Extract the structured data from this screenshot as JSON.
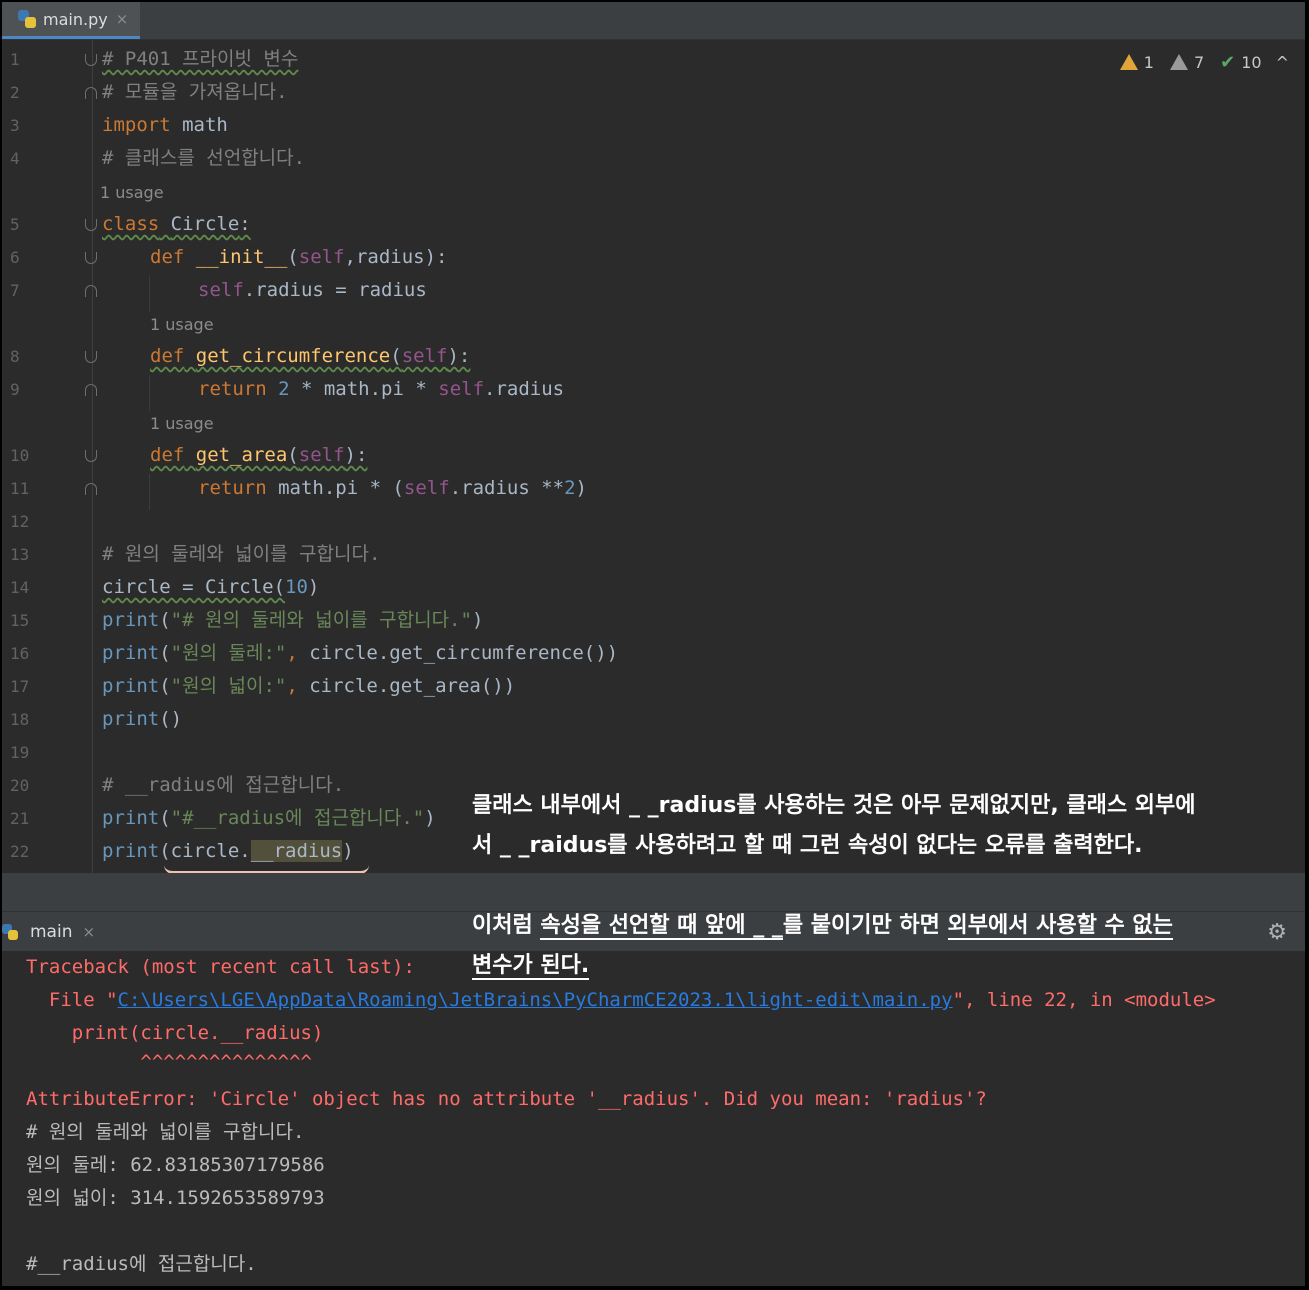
{
  "tab": {
    "filename": "main.py",
    "close": "×"
  },
  "inspections": {
    "warnings": "1",
    "weak_warnings": "7",
    "ok": "10",
    "collapse": "^"
  },
  "hints": {
    "usage_label": "1 usage"
  },
  "lines": {
    "l1": {
      "num": "1",
      "text": "# P401 프라이빗 변수"
    },
    "l2": {
      "num": "2",
      "text": "# 모듈을 가져옵니다."
    },
    "l3": {
      "num": "3",
      "kw": "import",
      "rest": " math"
    },
    "l4": {
      "num": "4",
      "text": "# 클래스를 선언합니다."
    },
    "l5": {
      "num": "5",
      "kw": "class",
      "name": "Circle",
      "tail": ":"
    },
    "l6": {
      "num": "6",
      "kw": "def",
      "name": "__init__",
      "p1": "(",
      "self": "self",
      "p2": ",radius):"
    },
    "l7": {
      "num": "7",
      "self": "self",
      "rest": ".radius = radius"
    },
    "l8": {
      "num": "8",
      "kw": "def",
      "name": "get_circumference",
      "p1": "(",
      "self": "self",
      "p2": "):"
    },
    "l9": {
      "num": "9",
      "kw": "return",
      "num_val": "2",
      "mid": " * math.pi * ",
      "self": "self",
      "rest": ".radius"
    },
    "l10": {
      "num": "10",
      "kw": "def",
      "name": "get_area",
      "p1": "(",
      "self": "self",
      "p2": "):"
    },
    "l11": {
      "num": "11",
      "kw": "return",
      "mid": " math.pi * (",
      "self": "self",
      "rest": ".radius **",
      "num_val": "2",
      "tail": ")"
    },
    "l12": {
      "num": "12"
    },
    "l13": {
      "num": "13",
      "text": "# 원의 둘레와 넓이를 구합니다."
    },
    "l14": {
      "num": "14",
      "pre": "circle = Circle(",
      "num_val": "10",
      "tail": ")"
    },
    "l15": {
      "num": "15",
      "fn": "print",
      "p1": "(",
      "str": "\"# 원의 둘레와 넓이를 구합니다.\"",
      "tail": ")"
    },
    "l16": {
      "num": "16",
      "fn": "print",
      "p1": "(",
      "str": "\"원의 둘레:\"",
      "comma": ",",
      "rest": " circle.get_circumference())"
    },
    "l17": {
      "num": "17",
      "fn": "print",
      "p1": "(",
      "str": "\"원의 넓이:\"",
      "comma": ",",
      "rest": " circle.get_area())"
    },
    "l18": {
      "num": "18",
      "fn": "print",
      "rest": "()"
    },
    "l19": {
      "num": "19"
    },
    "l20": {
      "num": "20",
      "text": "# __radius에 접근합니다."
    },
    "l21": {
      "num": "21",
      "fn": "print",
      "p1": "(",
      "str": "\"#__radius에 접근합니다.\"",
      "tail": ")"
    },
    "l22": {
      "num": "22",
      "fn": "print",
      "p1": "(",
      "obj": "circle.",
      "attr": "__radius",
      "tail": ")"
    }
  },
  "annotation": {
    "line1": "클래스 내부에서 _ _radius를 사용하는 것은 아무 문제없지만, 클래스 외부에",
    "line2": "서 _ _raidus를 사용하려고 할 때 그런 속성이 없다는 오류를 출력한다.",
    "line3_a": "이처럼 ",
    "line3_b": "속성을 선언할 때 앞에 _ _",
    "line3_c": "를 붙이기만 하면 ",
    "line3_d": "외부에서 사용할 수 없는",
    "line4": "변수가 된다."
  },
  "run": {
    "tab_label": "main",
    "close": "×"
  },
  "console": {
    "traceback": "Traceback (most recent call last):",
    "file_prefix": "  File \"",
    "file_path": "C:\\Users\\LGE\\AppData\\Roaming\\JetBrains\\PyCharmCE2023.1\\light-edit\\main.py",
    "file_suffix": "\", line 22, in <module>",
    "code": "    print(circle.__radius)",
    "carets": "          ^^^^^^^^^^^^^^^",
    "error": "AttributeError: 'Circle' object has no attribute '__radius'. Did you mean: 'radius'?",
    "out1": "# 원의 둘레와 넓이를 구합니다.",
    "out2": "원의 둘레: 62.83185307179586",
    "out3": "원의 넓이: 314.1592653589793",
    "out4": "",
    "out5": "#__radius에 접근합니다."
  }
}
